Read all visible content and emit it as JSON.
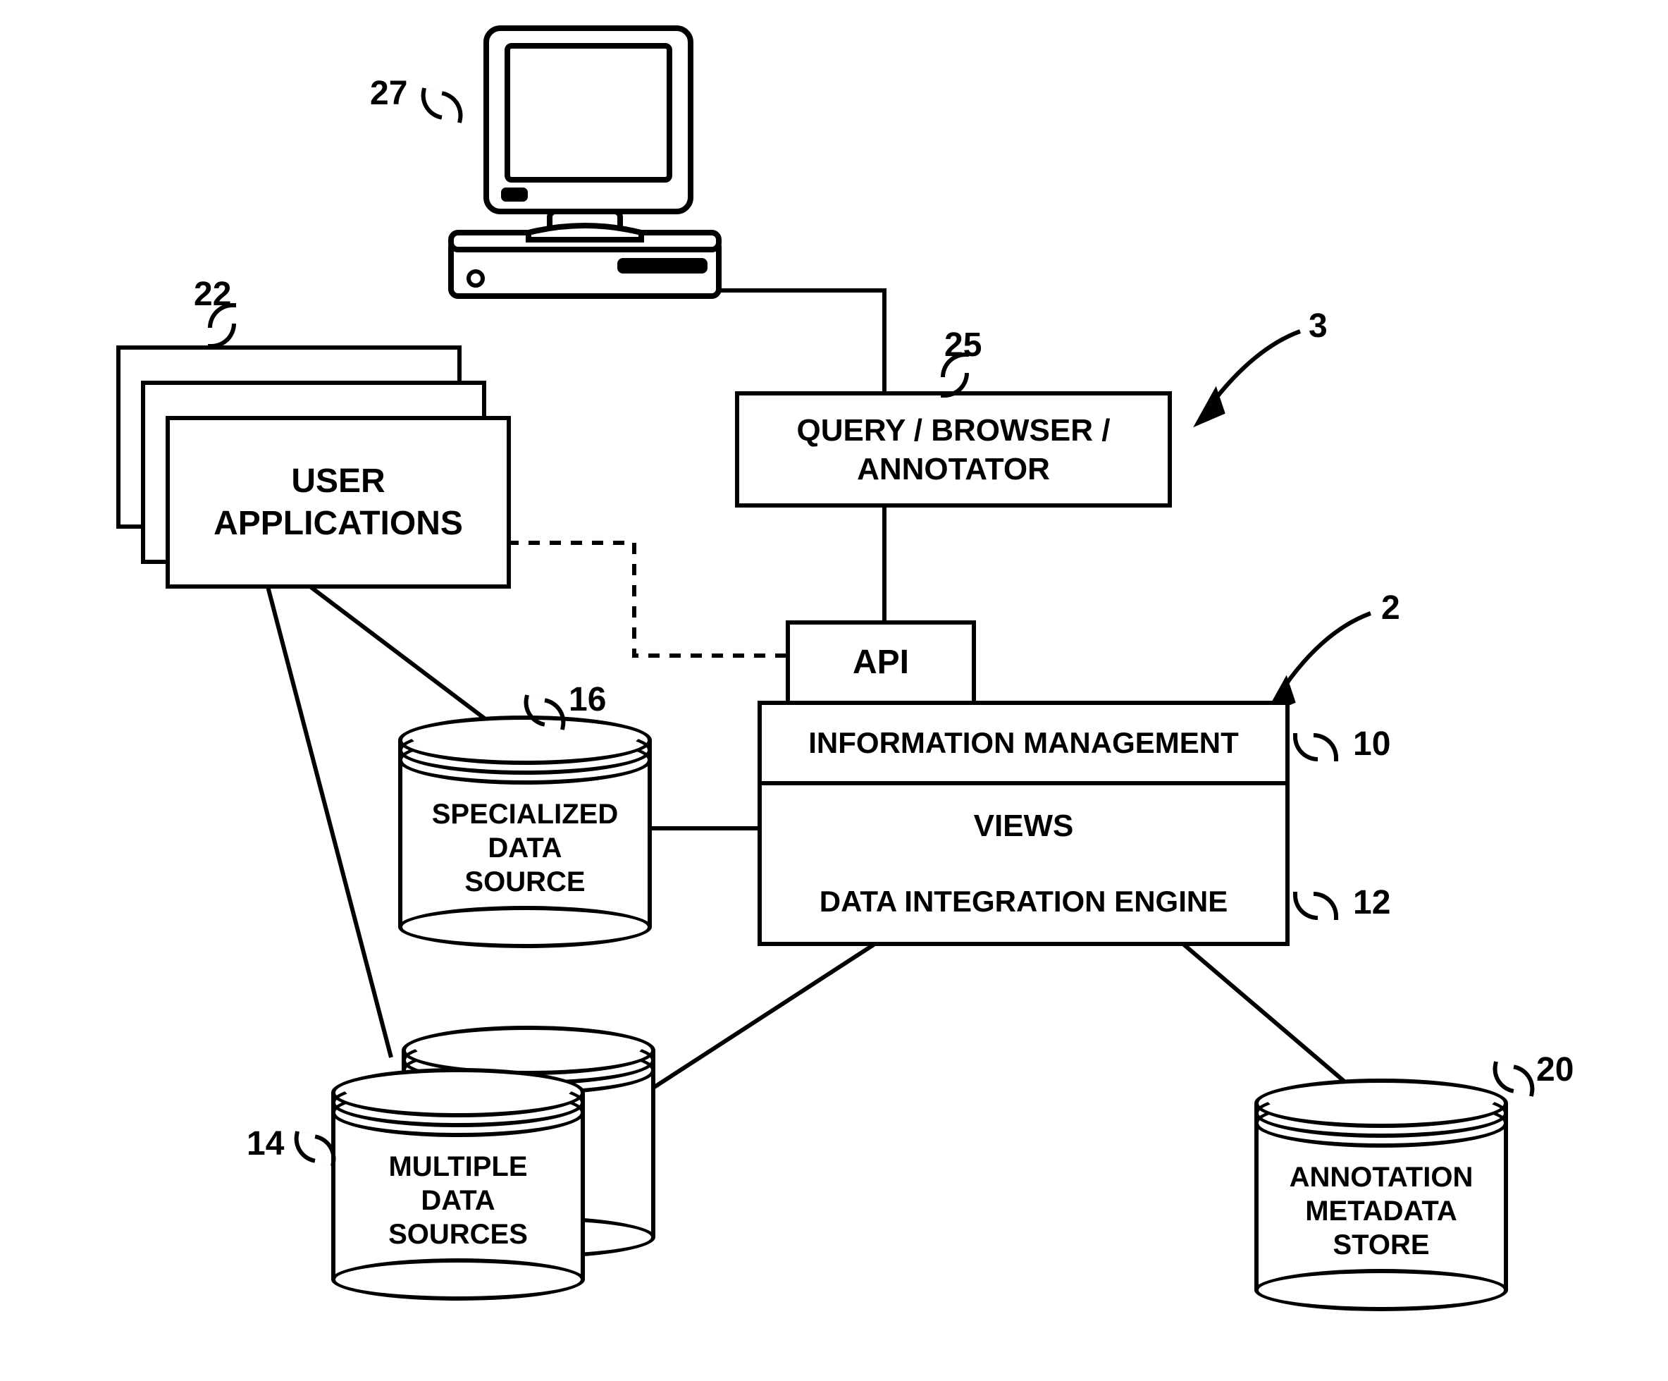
{
  "refs": {
    "r27": "27",
    "r22": "22",
    "r25": "25",
    "r3": "3",
    "r2": "2",
    "r10": "10",
    "r12": "12",
    "r16": "16",
    "r14": "14",
    "r20": "20"
  },
  "boxes": {
    "user_apps": "USER\nAPPLICATIONS",
    "query_browser": "QUERY / BROWSER /\nANNOTATOR",
    "api": "API",
    "info_mgmt": "INFORMATION MANAGEMENT",
    "views": "VIEWS",
    "data_engine": "DATA INTEGRATION ENGINE"
  },
  "cylinders": {
    "specialized": "SPECIALIZED\nDATA\nSOURCE",
    "multiple": "MULTIPLE\nDATA\nSOURCES",
    "annotation": "ANNOTATION\nMETADATA\nSTORE"
  }
}
